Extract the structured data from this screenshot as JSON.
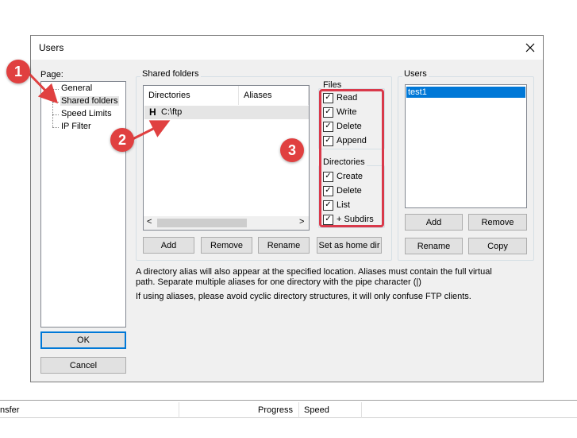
{
  "window": {
    "title": "Users",
    "close_glyph": "✕"
  },
  "page_panel": {
    "label": "Page:",
    "items": [
      "General",
      "Shared folders",
      "Speed Limits",
      "IP Filter"
    ],
    "selected": "Shared folders"
  },
  "shared_folders": {
    "group_label": "Shared folders",
    "columns": [
      "Directories",
      "Aliases"
    ],
    "rows": [
      {
        "flag": "H",
        "directory": "C:\\ftp",
        "alias": ""
      }
    ],
    "scroll_left": "<",
    "scroll_right": ">",
    "buttons": {
      "add": "Add",
      "remove": "Remove",
      "rename": "Rename",
      "set_home": "Set as home dir"
    }
  },
  "files": {
    "label": "Files",
    "options": [
      {
        "label": "Read",
        "checked": true
      },
      {
        "label": "Write",
        "checked": true
      },
      {
        "label": "Delete",
        "checked": true
      },
      {
        "label": "Append",
        "checked": true
      }
    ]
  },
  "directories": {
    "label": "Directories",
    "options": [
      {
        "label": "Create",
        "checked": true
      },
      {
        "label": "Delete",
        "checked": true
      },
      {
        "label": "List",
        "checked": true
      },
      {
        "label": "+ Subdirs",
        "checked": true
      }
    ]
  },
  "users": {
    "group_label": "Users",
    "items": [
      "test1"
    ],
    "selected": "test1",
    "buttons": {
      "add": "Add",
      "remove": "Remove",
      "rename": "Rename",
      "copy": "Copy"
    }
  },
  "info": {
    "line1": "A directory alias will also appear at the specified location. Aliases must contain the full virtual",
    "line2": "path. Separate multiple aliases for one directory with the pipe character (|)",
    "line3": "If using aliases, please avoid cyclic directory structures, it will only confuse FTP clients."
  },
  "dialog_buttons": {
    "ok": "OK",
    "cancel": "Cancel"
  },
  "status_bar": {
    "col1": "nsfer",
    "col2": "Progress",
    "col3": "Speed"
  },
  "annotations": {
    "badges": [
      "1",
      "2",
      "3"
    ],
    "color": "#e04040"
  },
  "colors": {
    "selection": "#0078d7",
    "accent_border": "#0078d7",
    "annotation_red": "#d9394a"
  }
}
